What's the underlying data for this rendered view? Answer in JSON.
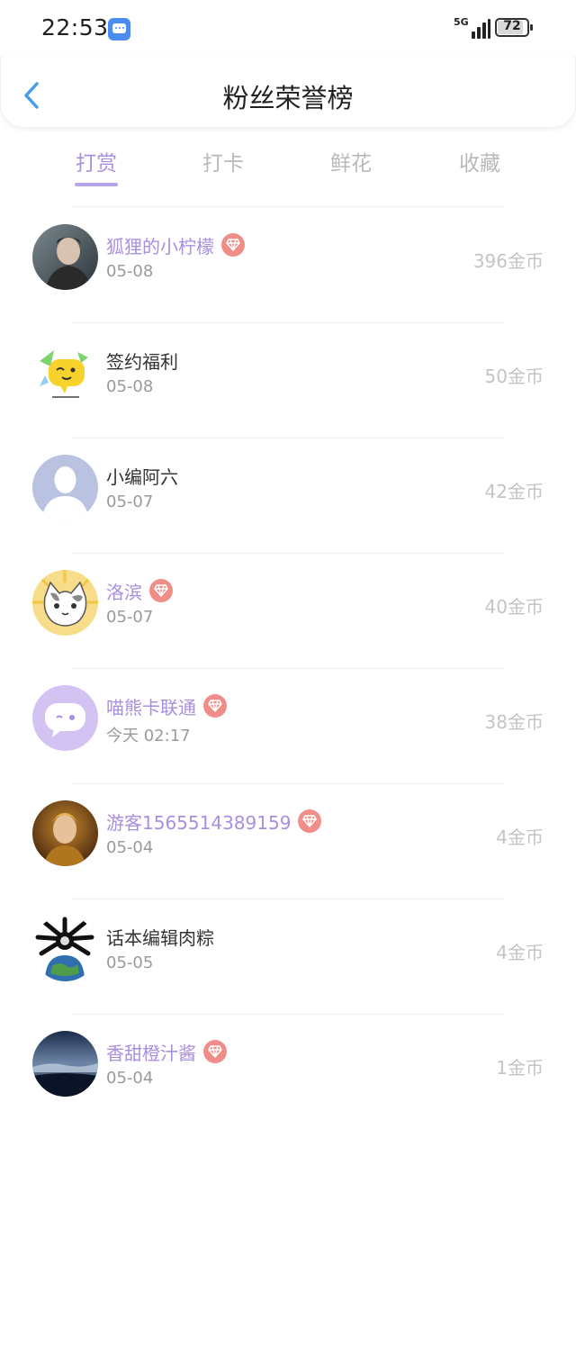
{
  "status_bar": {
    "time": "22:53",
    "network": "5G",
    "battery": "72"
  },
  "header": {
    "title": "粉丝荣誉榜"
  },
  "tabs": [
    {
      "label": "打赏",
      "active": true
    },
    {
      "label": "打卡",
      "active": false
    },
    {
      "label": "鲜花",
      "active": false
    },
    {
      "label": "收藏",
      "active": false
    }
  ],
  "colors": {
    "accent": "#a88fe0",
    "badge": "#ef8e89",
    "back_arrow": "#4a9be8"
  },
  "rows": [
    {
      "name": "狐狸的小柠檬",
      "date": "05-08",
      "amount": "396金币",
      "vip": true,
      "avatar": "photo-avatar"
    },
    {
      "name": "签约福利",
      "date": "05-08",
      "amount": "50金币",
      "vip": false,
      "avatar": "emoji-avatar"
    },
    {
      "name": "小编阿六",
      "date": "05-07",
      "amount": "42金币",
      "vip": false,
      "avatar": "default-avatar"
    },
    {
      "name": "洛滨",
      "date": "05-07",
      "amount": "40金币",
      "vip": true,
      "avatar": "cat-avatar"
    },
    {
      "name": "喵熊卡联通",
      "date": "今天 02:17",
      "amount": "38金币",
      "vip": true,
      "avatar": "chat-bubble-avatar"
    },
    {
      "name": "游客1565514389159",
      "date": "05-04",
      "amount": "4金币",
      "vip": true,
      "avatar": "photo-avatar"
    },
    {
      "name": "话本编辑肉粽",
      "date": "05-05",
      "amount": "4金币",
      "vip": false,
      "avatar": "earth-avatar"
    },
    {
      "name": "香甜橙汁酱",
      "date": "05-04",
      "amount": "1金币",
      "vip": true,
      "avatar": "landscape-avatar"
    }
  ]
}
